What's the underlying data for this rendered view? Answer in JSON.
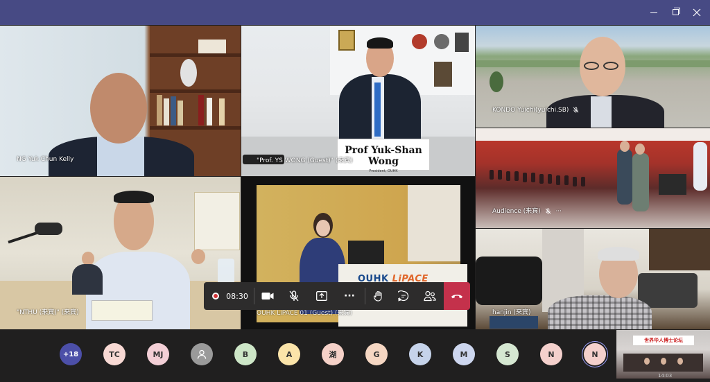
{
  "window": {
    "controls": {
      "minimize": "minimize",
      "maximize": "maximize",
      "close": "close"
    }
  },
  "tiles": {
    "t1": {
      "label": "NG Yuk Chun Kelly"
    },
    "t2": {
      "label": "\"Prof. YS WONG (Guest)\" (来宾)",
      "nameplate_name": "Prof Yuk-Shan Wong",
      "nameplate_sub": "President, OUHK"
    },
    "t3": {
      "label": "KONDO Yuichi(yuichi.SB)"
    },
    "t4": {
      "label": "Audience (来宾)",
      "more": "···"
    },
    "t5": {
      "label": "\"NTHU (来宾)\" (来宾)"
    },
    "t6": {
      "label": "OUHK LiPACE 01 (Guest) (来宾)",
      "podium_logo_main": "OUHK ",
      "podium_logo_accent": "LiPACE"
    },
    "t7": {
      "label": "hanjin (来宾)"
    }
  },
  "toolbar": {
    "timer": "08:30",
    "camera": "camera",
    "mic": "mic-off",
    "share": "share",
    "more": "···",
    "raise_hand": "raise-hand",
    "chat": "chat",
    "participants": "participants",
    "hangup": "hang-up"
  },
  "participants": [
    {
      "initials": "+18",
      "color": "#4c4fa8",
      "kind": "overflow"
    },
    {
      "initials": "TC",
      "color": "#f8d9d4"
    },
    {
      "initials": "MJ",
      "color": "#f3cfd6"
    },
    {
      "initials": "",
      "color": "#9a9a9a",
      "kind": "generic"
    },
    {
      "initials": "B",
      "color": "#cde6c7"
    },
    {
      "initials": "A",
      "color": "#fbe4a9"
    },
    {
      "initials": "湖",
      "color": "#f5d1c8"
    },
    {
      "initials": "G",
      "color": "#f6d7c3"
    },
    {
      "initials": "K",
      "color": "#c6d3ea"
    },
    {
      "initials": "M",
      "color": "#cdd6ee"
    },
    {
      "initials": "S",
      "color": "#d5e7d1"
    },
    {
      "initials": "N",
      "color": "#f4d0cc"
    },
    {
      "initials": "N",
      "color": "#f4d0cc",
      "selected": true
    }
  ],
  "self_preview": {
    "banner": "世界华人博士论坛",
    "time": "14:03"
  }
}
